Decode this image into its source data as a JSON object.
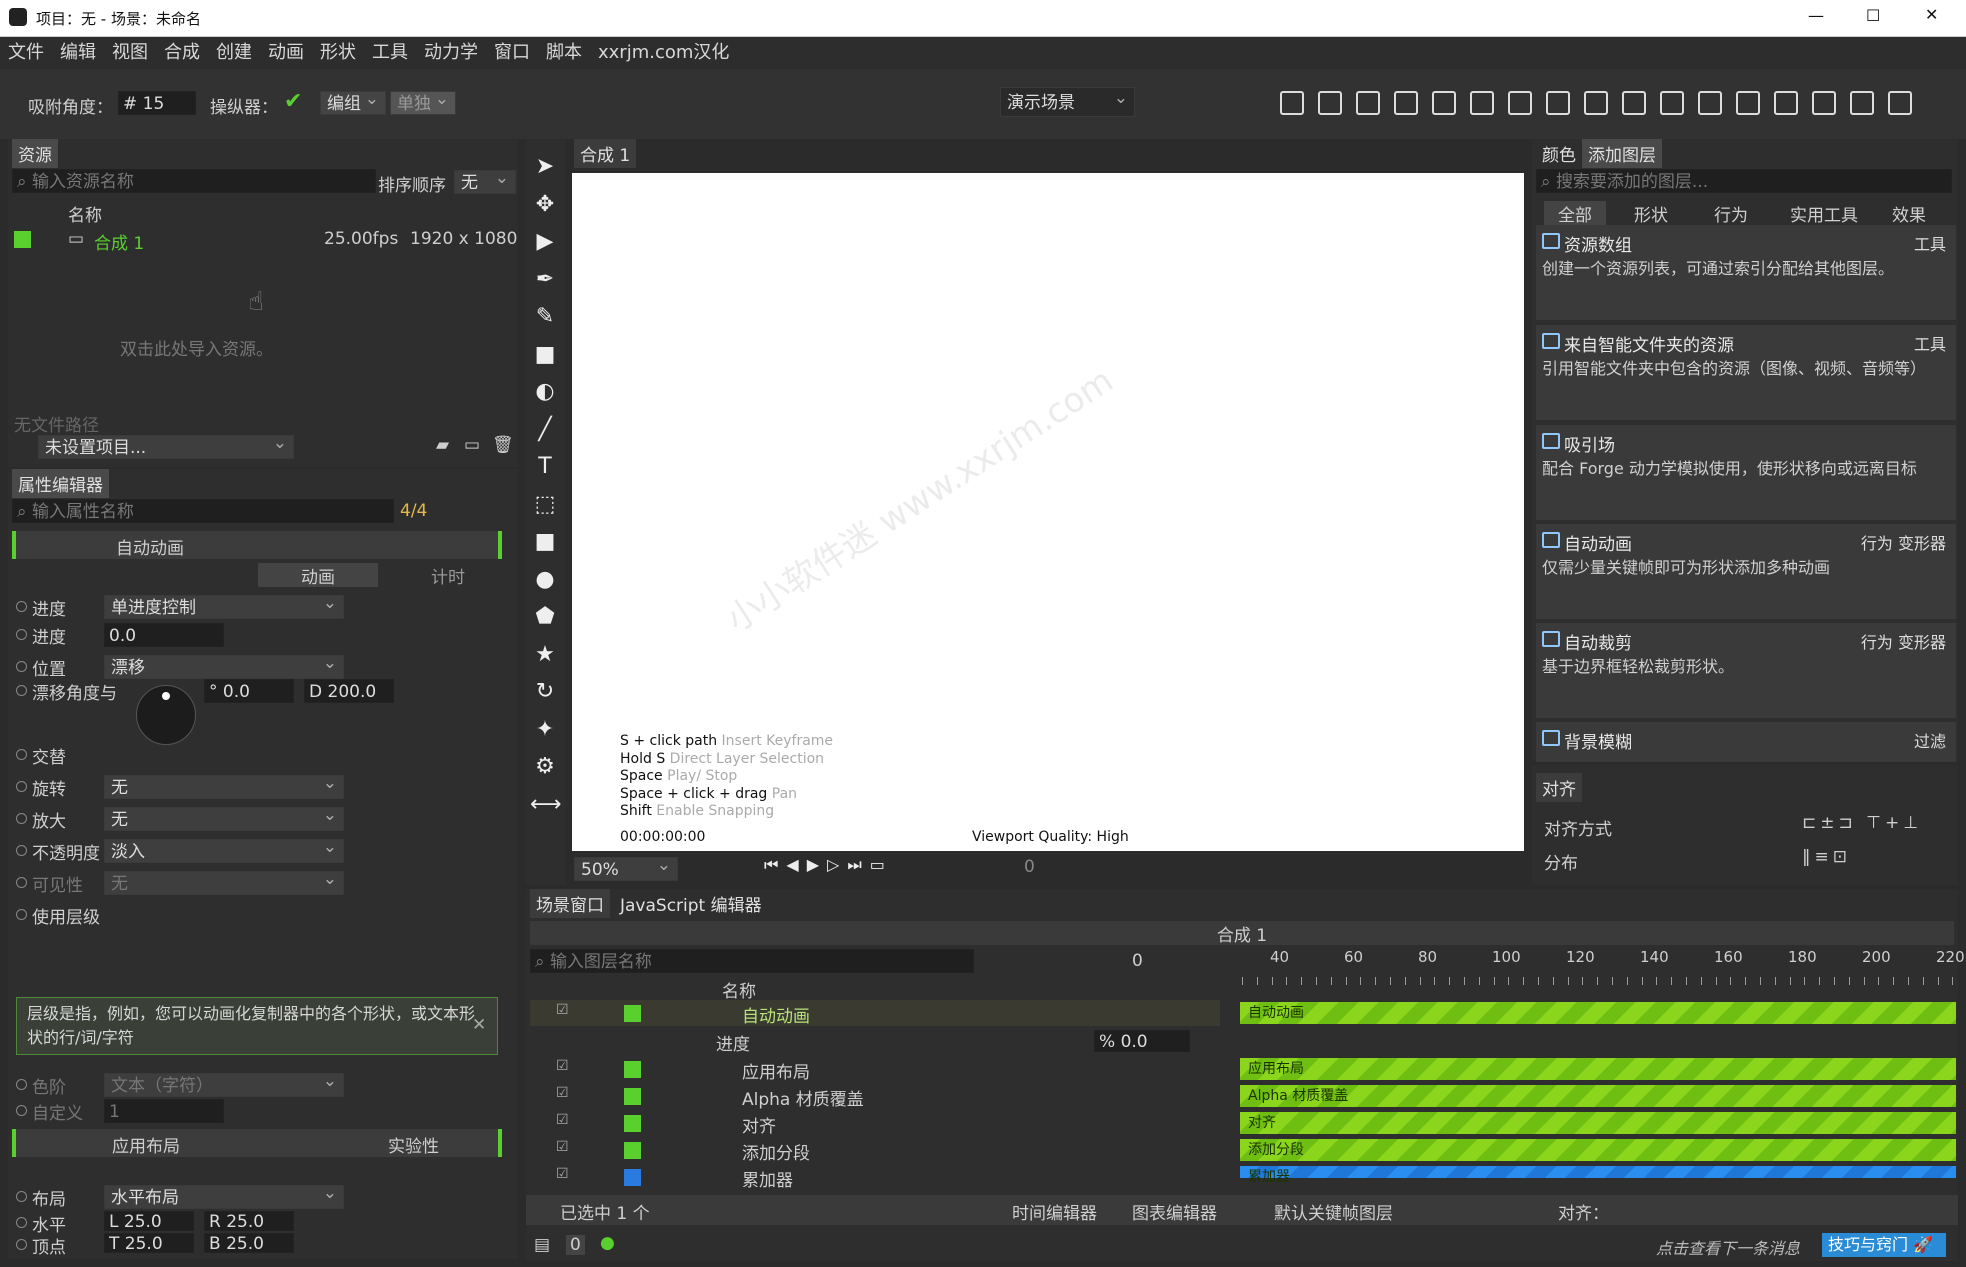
{
  "window": {
    "title": "项目：无 - 场景：未命名",
    "controls": [
      "—",
      "☐",
      "✕"
    ]
  },
  "menu": [
    "文件",
    "编辑",
    "视图",
    "合成",
    "创建",
    "动画",
    "形状",
    "工具",
    "动力学",
    "窗口",
    "脚本",
    "xxrjm.com汉化"
  ],
  "toolbar": {
    "snap_label": "吸附角度：",
    "snap_value": "15",
    "manip_label": "操纵器：",
    "group_btn": "编组",
    "single_btn": "单独",
    "scene_btn": "演示场景"
  },
  "assets": {
    "tab": "资源",
    "search_placeholder": "输入资源名称",
    "sort_label": "排序顺序",
    "sort_value": "无",
    "col_name": "名称",
    "item_name": "合成 1",
    "item_fps": "25.00fps",
    "item_size": "1920 x 1080",
    "hint": "双击此处导入资源。",
    "no_path": "无文件路径",
    "project": "未设置项目..."
  },
  "props": {
    "tab": "属性编辑器",
    "search_placeholder": "输入属性名称",
    "count": "4/4",
    "layer": "自动动画",
    "tab_anim": "动画",
    "tab_time": "计时",
    "progress_label": "进度",
    "progress_mode": "单进度控制",
    "progress_value": "0.0",
    "position_label": "位置",
    "position_mode": "漂移",
    "drift_label": "漂移角度与",
    "drift_angle": "0.0",
    "drift_dist": "200.0",
    "alternate": "交替",
    "rotate": "旋转",
    "rotate_v": "无",
    "scale": "放大",
    "scale_v": "无",
    "opacity": "不透明度",
    "opacity_v": "淡入",
    "visibility": "可见性",
    "visibility_v": "无",
    "use_levels": "使用层级",
    "levels_hint": "层级是指，例如，您可以动画化复制器中的各个形状，或文本形状的行/词/字符",
    "levels_sel_label": "色阶",
    "levels_sel": "文本（字符）",
    "custom": "自定义",
    "custom_v": "1",
    "layer2": "应用布局",
    "experimental": "实验性",
    "layout_label": "布局",
    "layout_v": "水平布局",
    "horiz": "水平",
    "vert": "顶点",
    "l": "25.0",
    "r": "25.0",
    "t": "25.0",
    "b": "25.0"
  },
  "viewport": {
    "tab": "合成 1",
    "hints": [
      [
        "S + click path",
        "Insert Keyframe"
      ],
      [
        "Hold S",
        "Direct Layer Selection"
      ],
      [
        "Space",
        "Play/ Stop"
      ],
      [
        "Space + click + drag",
        "Pan"
      ],
      [
        "Shift",
        "Enable Snapping"
      ]
    ],
    "timecode": "00:00:00:00",
    "quality": "Viewport Quality: High",
    "zoom": "50%",
    "frame": "0",
    "watermark": "小小软件迷 www.xxrjm.com"
  },
  "library": {
    "tab1": "颜色",
    "tab2": "添加图层",
    "search_placeholder": "搜索要添加的图层...",
    "filters": [
      "全部",
      "形状",
      "行为",
      "实用工具",
      "效果"
    ],
    "cards": [
      {
        "title": "资源数组",
        "tags": "工具",
        "desc": "创建一个资源列表，可通过索引分配给其他图层。"
      },
      {
        "title": "来自智能文件夹的资源",
        "tags": "工具",
        "desc": "引用智能文件夹中包含的资源（图像、视频、音频等）"
      },
      {
        "title": "吸引场",
        "tags": "",
        "desc": "配合 Forge 动力学模拟使用，使形状移向或远离目标"
      },
      {
        "title": "自动动画",
        "tags": "行为 变形器",
        "desc": "仅需少量关键帧即可为形状添加多种动画"
      },
      {
        "title": "自动裁剪",
        "tags": "行为 变形器",
        "desc": "基于边界框轻松裁剪形状。"
      },
      {
        "title": "背景模糊",
        "tags": "过滤",
        "desc": ""
      }
    ]
  },
  "align": {
    "tab": "对齐",
    "mode": "对齐方式",
    "dist": "分布"
  },
  "timeline": {
    "tab1": "场景窗口",
    "tab2": "JavaScript 编辑器",
    "comp": "合成 1",
    "search_placeholder": "输入图层名称",
    "frame": "0",
    "col_name": "名称",
    "ticks": [
      "40",
      "60",
      "80",
      "100",
      "120",
      "140",
      "160",
      "180",
      "200",
      "220"
    ],
    "layers": [
      "自动动画",
      "进度",
      "应用布局",
      "Alpha 材质覆盖",
      "对齐",
      "添加分段",
      "累加器"
    ],
    "progress_value": "0.0",
    "selected": "已选中 1 个",
    "time_editor": "时间编辑器",
    "graph_editor": "图表编辑器",
    "default_kf": "默认关键帧图层",
    "align_label": "对齐："
  },
  "status": {
    "count": "0",
    "next_msg": "点击查看下一条消息",
    "tips": "技巧与窍门"
  }
}
